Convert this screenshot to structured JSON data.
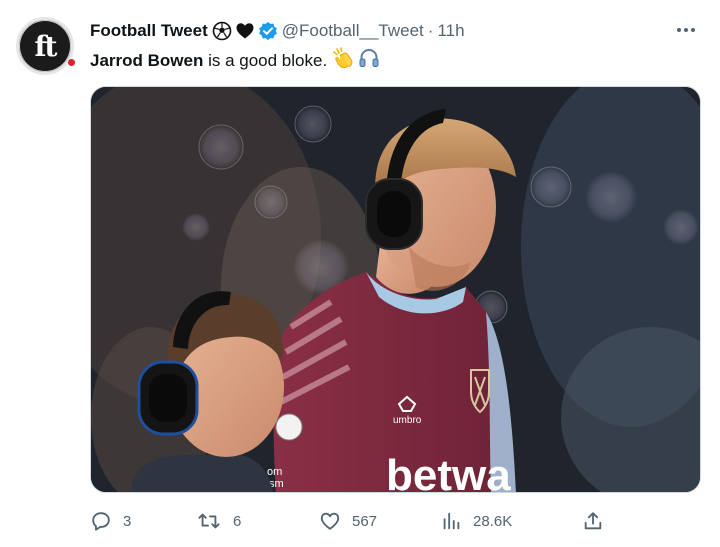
{
  "tweet": {
    "author_name": "Football Tweet",
    "author_emojis": [
      "soccer-ball-icon",
      "heart-icon"
    ],
    "verified": true,
    "handle": "@Football__Tweet",
    "separator": "·",
    "time": "11h",
    "text_bold": "Jarrod Bowen",
    "text_rest": " is a good bloke.",
    "text_emojis": [
      "clapping-hands-icon",
      "headphones-icon"
    ],
    "avatar_label": "ft",
    "photo": {
      "shirt_text": "betwa",
      "shirt_brand": "umbro",
      "sleeve_text_1": "om",
      "sleeve_text_2": "cism"
    }
  },
  "actions": {
    "replies": "3",
    "retweets": "6",
    "likes": "567",
    "views": "28.6K"
  },
  "colors": {
    "text": "#0f1419",
    "secondary": "#536471",
    "verified": "#1d9bf0",
    "shirt_claret": "#7a2a3e",
    "shirt_blue": "#9fc4e0"
  }
}
